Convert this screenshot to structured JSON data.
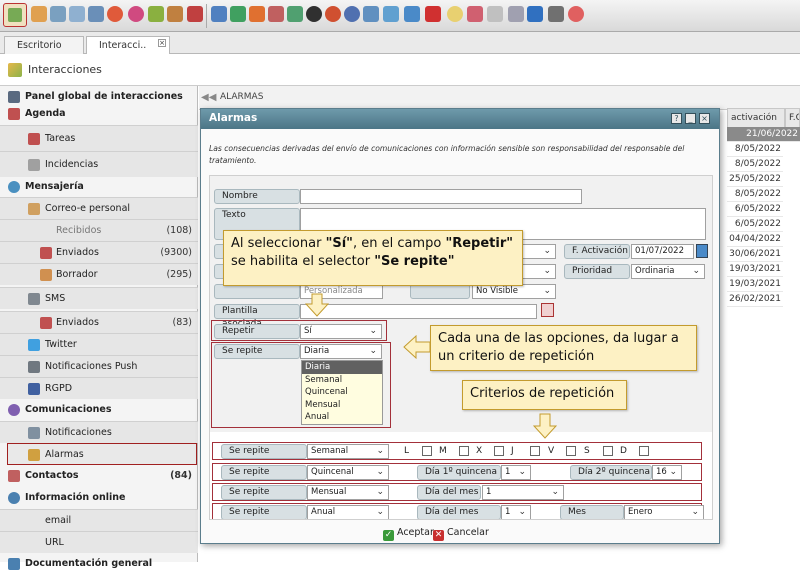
{
  "tabs": [
    {
      "label": "Escritorio"
    },
    {
      "label": "Interacci.."
    }
  ],
  "tab_close_glyph": "×",
  "section_title": "Interacciones",
  "sidebar": {
    "items": [
      {
        "label": "Panel global de interacciones",
        "count": ""
      },
      {
        "label": "Agenda",
        "count": ""
      },
      {
        "label": "Tareas",
        "count": ""
      },
      {
        "label": "Incidencias",
        "count": ""
      },
      {
        "label": "Mensajería",
        "count": ""
      },
      {
        "label": "Correo-e personal",
        "count": ""
      },
      {
        "label": "Recibidos",
        "count": "(108)"
      },
      {
        "label": "Enviados",
        "count": "(9300)"
      },
      {
        "label": "Borrador",
        "count": "(295)"
      },
      {
        "label": "SMS",
        "count": ""
      },
      {
        "label": "Enviados",
        "count": "(83)"
      },
      {
        "label": "Twitter",
        "count": ""
      },
      {
        "label": "Notificaciones Push",
        "count": ""
      },
      {
        "label": "RGPD",
        "count": ""
      },
      {
        "label": "Comunicaciones",
        "count": ""
      },
      {
        "label": "Notificaciones",
        "count": ""
      },
      {
        "label": "Alarmas",
        "count": ""
      },
      {
        "label": "Contactos",
        "count": "(84)"
      },
      {
        "label": "Información online",
        "count": ""
      },
      {
        "label": "email",
        "count": ""
      },
      {
        "label": "URL",
        "count": ""
      },
      {
        "label": "Documentación general",
        "count": ""
      }
    ]
  },
  "main": {
    "breadcrumb": "ALARMAS",
    "columns": [
      "activación",
      "F.Co"
    ],
    "dates": [
      "21/06/2022",
      "8/05/2022",
      "8/05/2022",
      "25/05/2022",
      "8/05/2022",
      "6/05/2022",
      "6/05/2022",
      "04/04/2022",
      "30/06/2021",
      "19/03/2021",
      "19/03/2021",
      "26/02/2021"
    ]
  },
  "dialog": {
    "title": "Alarmas",
    "help_glyph": "?",
    "minimize_glyph": "_",
    "close_glyph": "×",
    "notice": "Las consecuencias derivadas del envío de comunicaciones con información sensible son responsabilidad del responsable del tratamiento.",
    "labels": {
      "nombre": "Nombre",
      "texto": "Texto",
      "f_activacion": "F. Activación",
      "prioridad": "Prioridad",
      "plantilla": "Plantilla asociada",
      "repetir": "Repetir",
      "se_repite": "Se repite",
      "dia_1_quincena": "Día 1º quincena",
      "dia_2_quincena": "Día 2º quincena",
      "dia_del_mes": "Día del mes",
      "mes": "Mes"
    },
    "values": {
      "f_activacion": "01/07/2022",
      "prioridad": "Ordinaria",
      "repetir": "Sí",
      "se_repite": "Diaria",
      "row_partial_1": "Personalizada",
      "row_partial_2": "No Visible"
    },
    "dropdown_options": [
      "Diaria",
      "Semanal",
      "Quincenal",
      "Mensual",
      "Anual"
    ],
    "criteria_rows": [
      {
        "se_repite": "Semanal"
      },
      {
        "se_repite": "Quincenal",
        "dia1": "1",
        "dia2": "16"
      },
      {
        "se_repite": "Mensual",
        "dia_mes": "1"
      },
      {
        "se_repite": "Anual",
        "dia_mes": "1",
        "mes": "Enero"
      }
    ],
    "weekdays": [
      "L",
      "M",
      "X",
      "J",
      "V",
      "S",
      "D"
    ],
    "footer": {
      "accept": "Aceptar",
      "cancel": "Cancelar",
      "accept_glyph": "✓",
      "cancel_glyph": "✕"
    }
  },
  "callouts": {
    "repetir": {
      "pre": "Al seleccionar ",
      "q1": "\"Sí\"",
      "mid": ", en el campo ",
      "q2": "\"Repetir\"",
      "post": " se habilita el selector ",
      "q3": "\"Se repite\""
    },
    "opciones": "Cada una de las opciones, da lugar a un criterio de repetición",
    "criterios": "Criterios de repetición"
  },
  "colors": {
    "dialog_title": "#4c7586",
    "callout_bg": "#fdf1c4",
    "highlight_border": "#a3303a"
  }
}
